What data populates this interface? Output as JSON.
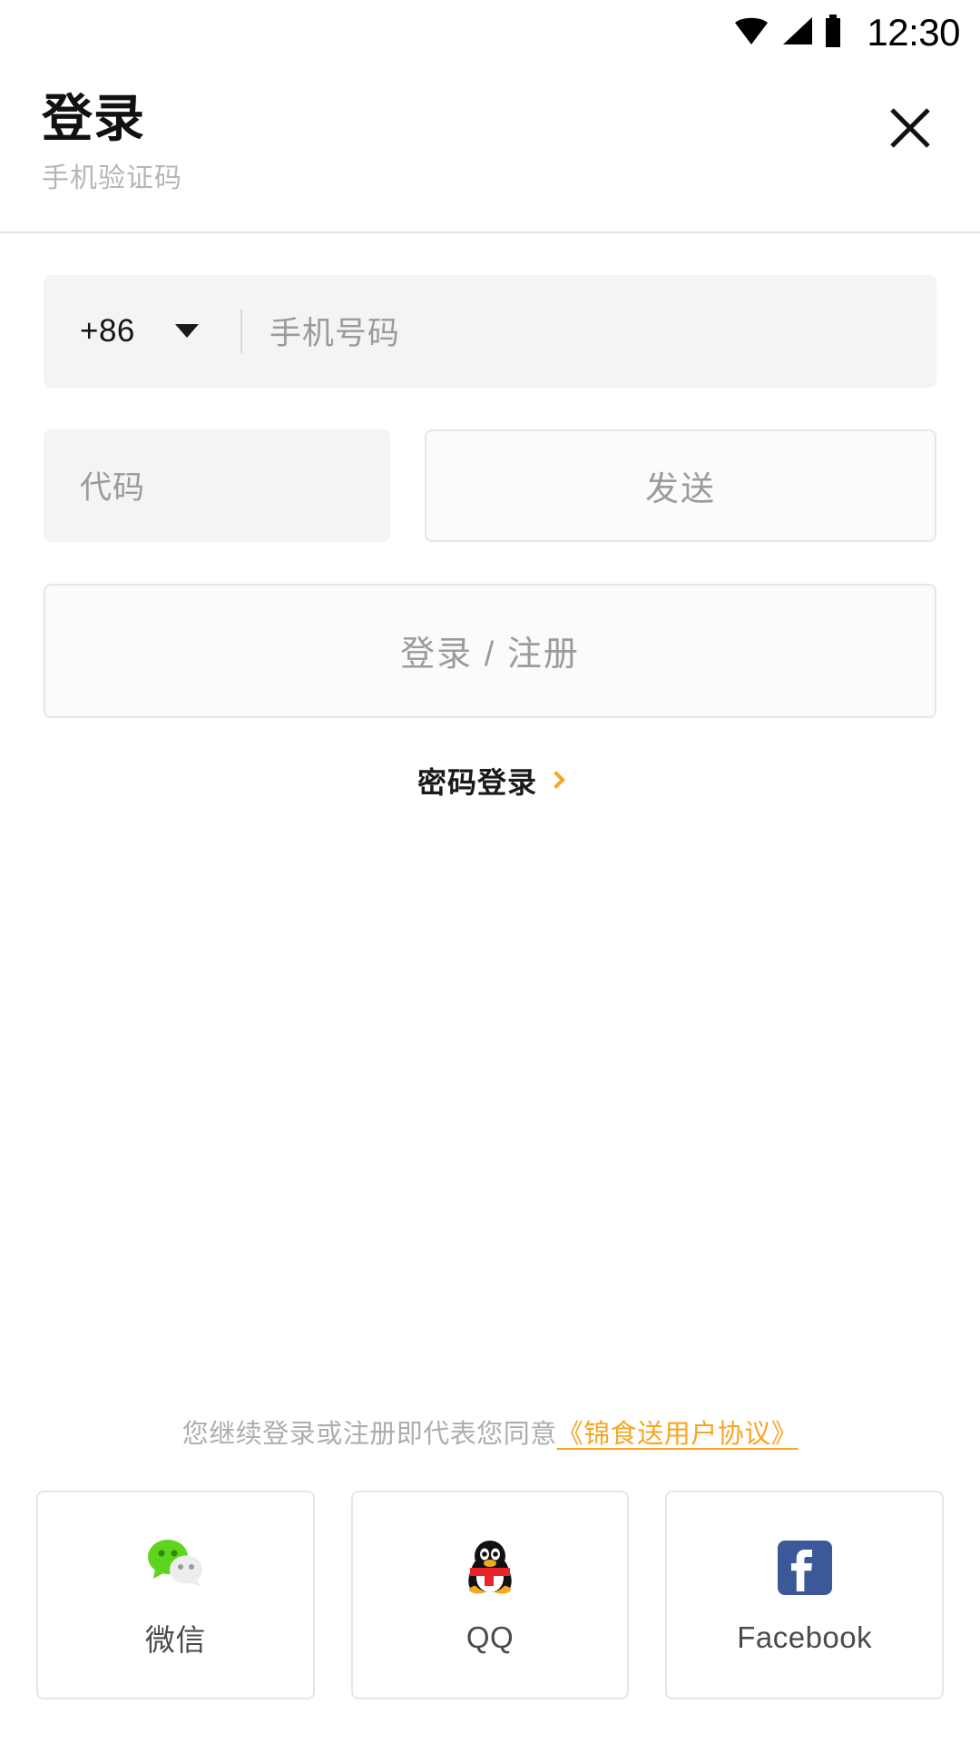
{
  "status_bar": {
    "time": "12:30",
    "icons": [
      "wifi-icon",
      "signal-icon",
      "battery-icon"
    ]
  },
  "header": {
    "title": "登录",
    "subtitle": "手机验证码",
    "close_icon": "close-icon"
  },
  "form": {
    "phone": {
      "country_code": "+86",
      "caret_icon": "chevron-down-icon",
      "placeholder": "手机号码",
      "value": ""
    },
    "code": {
      "placeholder": "代码",
      "value": ""
    },
    "send_label": "发送",
    "login_label": "登录 / 注册",
    "password_login_label": "密码登录",
    "password_login_chevron": "chevron-right-icon"
  },
  "agreement": {
    "text": "您继续登录或注册即代表您同意",
    "link": "《锦食送用户协议》"
  },
  "social": {
    "items": [
      {
        "label": "微信",
        "icon": "wechat-icon"
      },
      {
        "label": "QQ",
        "icon": "qq-icon"
      },
      {
        "label": "Facebook",
        "icon": "facebook-icon"
      }
    ]
  },
  "colors": {
    "accent": "#f5a623",
    "field_bg": "#f4f4f4",
    "border": "#e6e6e6",
    "muted_text": "#9b9b9b",
    "wechat_green": "#5fd41c",
    "facebook_blue": "#3b5998",
    "qq_scarf_red": "#e8242a",
    "qq_beak_orange": "#f7a823"
  }
}
